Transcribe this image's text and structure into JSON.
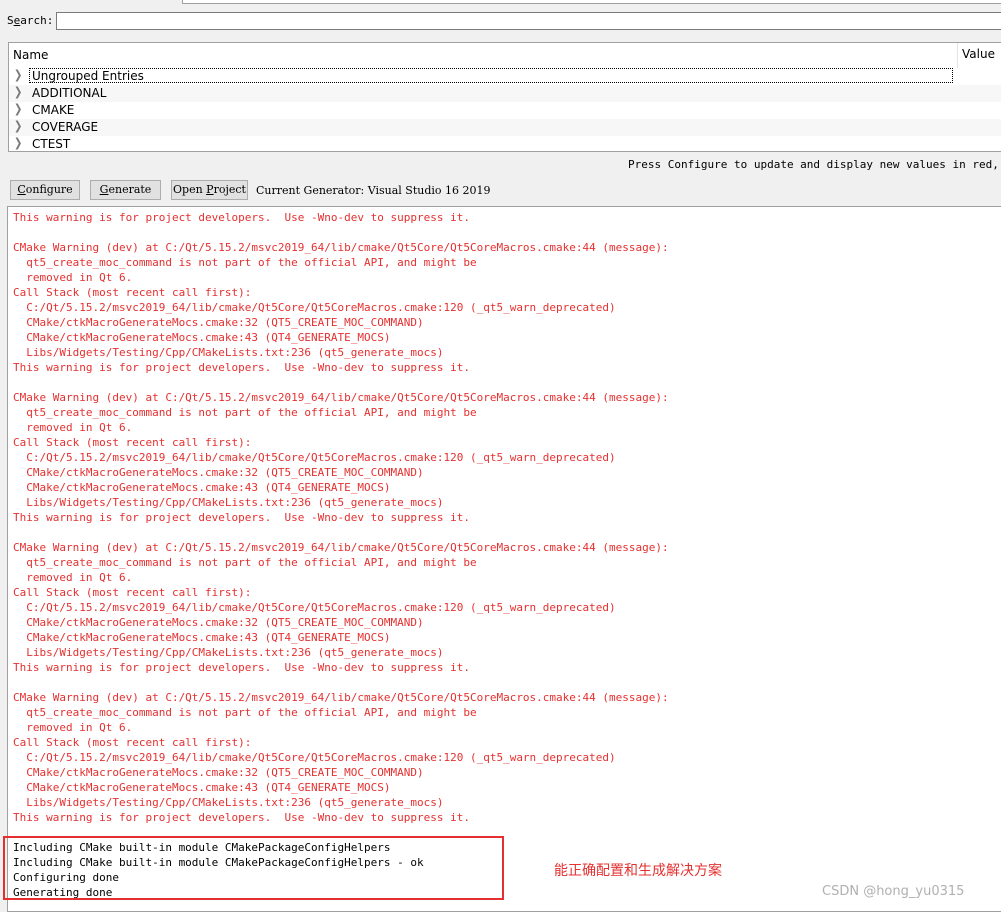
{
  "search": {
    "label_pre": "S",
    "label_key": "e",
    "label_post": "arch:",
    "value": ""
  },
  "tree": {
    "columns": {
      "name": "Name",
      "value": "Value"
    },
    "items": [
      {
        "label": "Ungrouped Entries"
      },
      {
        "label": "ADDITIONAL"
      },
      {
        "label": "CMAKE"
      },
      {
        "label": "COVERAGE"
      },
      {
        "label": "CTEST"
      }
    ]
  },
  "hint_text": "Press Configure to update and display new values in red, then",
  "toolbar": {
    "configure": {
      "key": "C",
      "rest": "onfigure"
    },
    "generate": {
      "key": "G",
      "rest": "enerate"
    },
    "open_project": {
      "pre": "Open ",
      "key": "P",
      "rest": "roject"
    },
    "current_generator": "Current Generator: Visual Studio 16 2019"
  },
  "output": {
    "warning_lines": [
      "This warning is for project developers.  Use -Wno-dev to suppress it.",
      "",
      "CMake Warning (dev) at C:/Qt/5.15.2/msvc2019_64/lib/cmake/Qt5Core/Qt5CoreMacros.cmake:44 (message):",
      "  qt5_create_moc_command is not part of the official API, and might be",
      "  removed in Qt 6.",
      "Call Stack (most recent call first):",
      "  C:/Qt/5.15.2/msvc2019_64/lib/cmake/Qt5Core/Qt5CoreMacros.cmake:120 (_qt5_warn_deprecated)",
      "  CMake/ctkMacroGenerateMocs.cmake:32 (QT5_CREATE_MOC_COMMAND)",
      "  CMake/ctkMacroGenerateMocs.cmake:43 (QT4_GENERATE_MOCS)",
      "  Libs/Widgets/Testing/Cpp/CMakeLists.txt:236 (qt5_generate_mocs)",
      "This warning is for project developers.  Use -Wno-dev to suppress it.",
      "",
      "CMake Warning (dev) at C:/Qt/5.15.2/msvc2019_64/lib/cmake/Qt5Core/Qt5CoreMacros.cmake:44 (message):",
      "  qt5_create_moc_command is not part of the official API, and might be",
      "  removed in Qt 6.",
      "Call Stack (most recent call first):",
      "  C:/Qt/5.15.2/msvc2019_64/lib/cmake/Qt5Core/Qt5CoreMacros.cmake:120 (_qt5_warn_deprecated)",
      "  CMake/ctkMacroGenerateMocs.cmake:32 (QT5_CREATE_MOC_COMMAND)",
      "  CMake/ctkMacroGenerateMocs.cmake:43 (QT4_GENERATE_MOCS)",
      "  Libs/Widgets/Testing/Cpp/CMakeLists.txt:236 (qt5_generate_mocs)",
      "This warning is for project developers.  Use -Wno-dev to suppress it.",
      "",
      "CMake Warning (dev) at C:/Qt/5.15.2/msvc2019_64/lib/cmake/Qt5Core/Qt5CoreMacros.cmake:44 (message):",
      "  qt5_create_moc_command is not part of the official API, and might be",
      "  removed in Qt 6.",
      "Call Stack (most recent call first):",
      "  C:/Qt/5.15.2/msvc2019_64/lib/cmake/Qt5Core/Qt5CoreMacros.cmake:120 (_qt5_warn_deprecated)",
      "  CMake/ctkMacroGenerateMocs.cmake:32 (QT5_CREATE_MOC_COMMAND)",
      "  CMake/ctkMacroGenerateMocs.cmake:43 (QT4_GENERATE_MOCS)",
      "  Libs/Widgets/Testing/Cpp/CMakeLists.txt:236 (qt5_generate_mocs)",
      "This warning is for project developers.  Use -Wno-dev to suppress it.",
      "",
      "CMake Warning (dev) at C:/Qt/5.15.2/msvc2019_64/lib/cmake/Qt5Core/Qt5CoreMacros.cmake:44 (message):",
      "  qt5_create_moc_command is not part of the official API, and might be",
      "  removed in Qt 6.",
      "Call Stack (most recent call first):",
      "  C:/Qt/5.15.2/msvc2019_64/lib/cmake/Qt5Core/Qt5CoreMacros.cmake:120 (_qt5_warn_deprecated)",
      "  CMake/ctkMacroGenerateMocs.cmake:32 (QT5_CREATE_MOC_COMMAND)",
      "  CMake/ctkMacroGenerateMocs.cmake:43 (QT4_GENERATE_MOCS)",
      "  Libs/Widgets/Testing/Cpp/CMakeLists.txt:236 (qt5_generate_mocs)",
      "This warning is for project developers.  Use -Wno-dev to suppress it.",
      ""
    ],
    "status_lines": [
      "Including CMake built-in module CMakePackageConfigHelpers",
      "Including CMake built-in module CMakePackageConfigHelpers - ok",
      "Configuring done",
      "Generating done"
    ]
  },
  "annotation": "能正确配置和生成解决方案",
  "watermark": "CSDN @hong_yu0315",
  "colors": {
    "warning": "#e53030",
    "annotation_box": "#e53030"
  },
  "icons": {
    "expand": "chevron-right-icon"
  }
}
